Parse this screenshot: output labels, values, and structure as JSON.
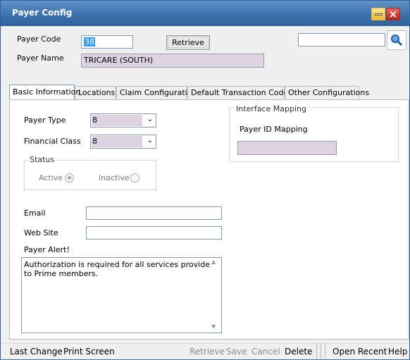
{
  "window": {
    "title": "Payer Config"
  },
  "header": {
    "payer_code_label": "Payer Code",
    "payer_code_value": "38",
    "retrieve_label": "Retrieve",
    "payer_name_label": "Payer Name",
    "payer_name_value": "TRICARE (SOUTH)",
    "search_value": ""
  },
  "tabs": [
    {
      "label": "Basic Information",
      "active": true
    },
    {
      "label": "Locations"
    },
    {
      "label": "Claim Configuration"
    },
    {
      "label": "Default Transaction Codes"
    },
    {
      "label": "Other Configurations"
    }
  ],
  "basic": {
    "payer_type_label": "Payer Type",
    "payer_type_value": "8",
    "financial_class_label": "Financial Class",
    "financial_class_value": "8",
    "status_label": "Status",
    "active_label": "Active",
    "inactive_label": "Inactive",
    "email_label": "Email",
    "email_value": "",
    "website_label": "Web Site",
    "website_value": "",
    "payer_alert_label": "Payer Alert!",
    "payer_alert_value": "Authorization is required for all services provided to Prime members."
  },
  "interface": {
    "group_title": "Interface Mapping",
    "payer_id_mapping_label": "Payer ID Mapping",
    "payer_id_mapping_value": ""
  },
  "bottom_bar": {
    "last_change": "Last Change",
    "print_screen": "Print Screen",
    "retrieve": "Retrieve",
    "save": "Save",
    "cancel": "Cancel",
    "delete": "Delete",
    "open_recent": "Open Recent",
    "help": "Help"
  },
  "icons": [
    "minimize-icon",
    "close-icon",
    "search-icon",
    "chevron-down-icon",
    "radio-icon"
  ],
  "colors": {
    "title_bar": "#3c72ad",
    "readonly_fill": "#ded3e3",
    "disabled_text": "#8c8c8c"
  }
}
